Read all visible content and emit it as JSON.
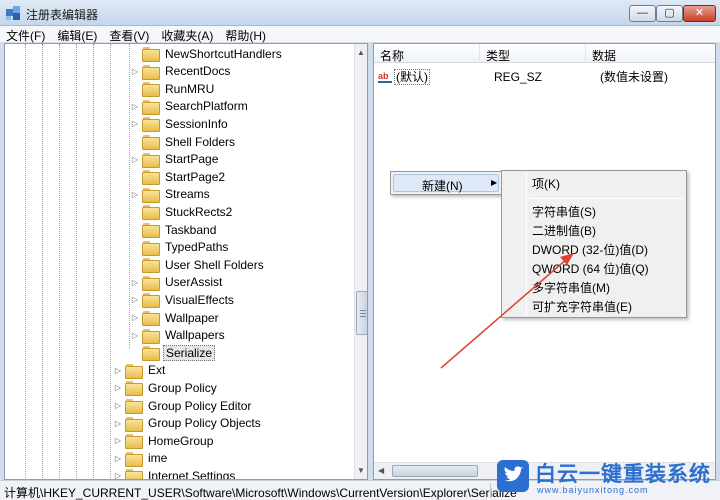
{
  "window": {
    "title": "注册表编辑器",
    "min_glyph": "—",
    "max_glyph": "▢",
    "close_glyph": "✕"
  },
  "menubar": [
    "文件(F)",
    "编辑(E)",
    "查看(V)",
    "收藏夹(A)",
    "帮助(H)"
  ],
  "tree": {
    "items": [
      {
        "label": "NewShortcutHandlers",
        "expander": ""
      },
      {
        "label": "RecentDocs",
        "expander": "▷"
      },
      {
        "label": "RunMRU",
        "expander": ""
      },
      {
        "label": "SearchPlatform",
        "expander": "▷"
      },
      {
        "label": "SessionInfo",
        "expander": "▷"
      },
      {
        "label": "Shell Folders",
        "expander": ""
      },
      {
        "label": "StartPage",
        "expander": "▷"
      },
      {
        "label": "StartPage2",
        "expander": ""
      },
      {
        "label": "Streams",
        "expander": "▷"
      },
      {
        "label": "StuckRects2",
        "expander": ""
      },
      {
        "label": "Taskband",
        "expander": ""
      },
      {
        "label": "TypedPaths",
        "expander": ""
      },
      {
        "label": "User Shell Folders",
        "expander": ""
      },
      {
        "label": "UserAssist",
        "expander": "▷"
      },
      {
        "label": "VisualEffects",
        "expander": "▷"
      },
      {
        "label": "Wallpaper",
        "expander": "▷"
      },
      {
        "label": "Wallpapers",
        "expander": "▷"
      },
      {
        "label": "Serialize",
        "expander": "",
        "selected": true
      },
      {
        "label": "Ext",
        "expander": "▷"
      },
      {
        "label": "Group Policy",
        "expander": "▷"
      },
      {
        "label": "Group Policy Editor",
        "expander": "▷"
      },
      {
        "label": "Group Policy Objects",
        "expander": "▷"
      },
      {
        "label": "HomeGroup",
        "expander": "▷"
      },
      {
        "label": "ime",
        "expander": "▷"
      },
      {
        "label": "Internet Settings",
        "expander": "▷"
      }
    ]
  },
  "list": {
    "columns": [
      "名称",
      "类型",
      "数据"
    ],
    "rows": [
      {
        "icon": "ab",
        "name": "(默认)",
        "type": "REG_SZ",
        "data": "(数值未设置)"
      }
    ]
  },
  "context_menu": {
    "new_label": "新建(N)",
    "submenu": [
      "项(K)",
      "字符串值(S)",
      "二进制值(B)",
      "DWORD (32-位)值(D)",
      "QWORD (64 位)值(Q)",
      "多字符串值(M)",
      "可扩充字符串值(E)"
    ]
  },
  "statusbar": {
    "path": "计算机\\HKEY_CURRENT_USER\\Software\\Microsoft\\Windows\\CurrentVersion\\Explorer\\Serialize"
  },
  "watermark": {
    "title": "白云一键重装系统",
    "url": "www.baiyunxitong.com"
  },
  "colors": {
    "accent_arrow": "#e04030",
    "watermark_blue": "#2d6fd0",
    "folder": "#e9bd4b"
  }
}
